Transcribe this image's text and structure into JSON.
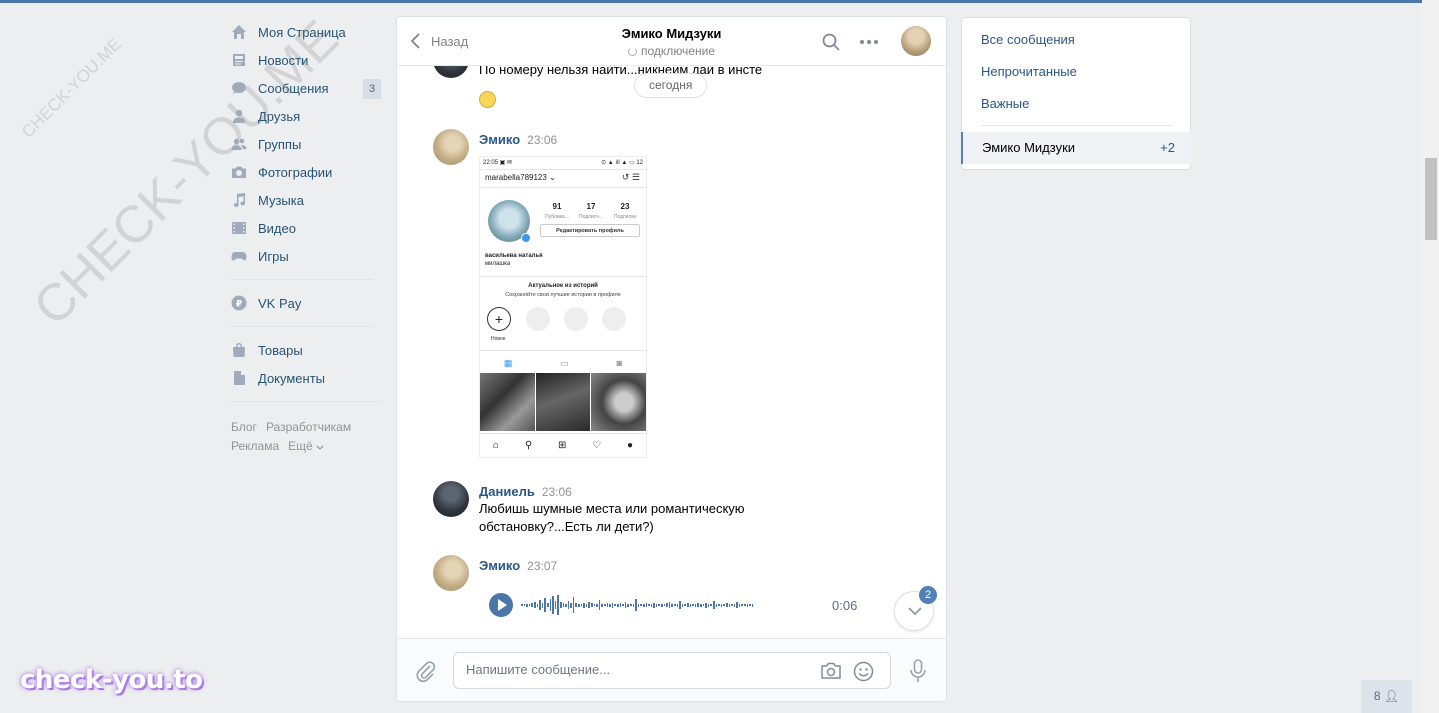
{
  "watermark": {
    "big": "CHECK-YOU.ME",
    "small": "CHECK-YOU.ME",
    "logo": "check-you.to"
  },
  "nav": {
    "items": [
      {
        "label": "Моя Страница",
        "icon": "home-icon"
      },
      {
        "label": "Новости",
        "icon": "news-icon"
      },
      {
        "label": "Сообщения",
        "icon": "messages-icon",
        "badge": "3"
      },
      {
        "label": "Друзья",
        "icon": "friends-icon"
      },
      {
        "label": "Группы",
        "icon": "groups-icon"
      },
      {
        "label": "Фотографии",
        "icon": "camera-icon"
      },
      {
        "label": "Музыка",
        "icon": "music-icon"
      },
      {
        "label": "Видео",
        "icon": "video-icon"
      },
      {
        "label": "Игры",
        "icon": "games-icon"
      }
    ],
    "pay": {
      "label": "VK Pay",
      "icon": "vkpay-icon"
    },
    "items2": [
      {
        "label": "Товары",
        "icon": "bag-icon"
      },
      {
        "label": "Документы",
        "icon": "document-icon"
      }
    ],
    "footer": {
      "blog": "Блог",
      "devs": "Разработчикам",
      "ads": "Реклама",
      "more": "Ещё"
    }
  },
  "chat": {
    "back": "Назад",
    "title": "Эмико Мидзуки",
    "status": "подключение",
    "day": "сегодня",
    "messages": {
      "m0": {
        "text": "По номеру нельзя найти...никнеим дай в инсте"
      },
      "m1": {
        "author": "Эмико",
        "time": "23:06"
      },
      "m2": {
        "author": "Даниель",
        "time": "23:06",
        "text": "Любишь шумные места или романтическую обстановку?...Есть ли дети?)"
      },
      "m3": {
        "author": "Эмико",
        "time": "23:07",
        "duration": "0:06"
      }
    },
    "shot": {
      "statusbar_left": "22:05 ▣ ✉",
      "statusbar_right": "⊙ ▲ ıll ▲ ▭ 12",
      "username": "marabella789123 ⌄",
      "stats": [
        "91",
        "17",
        "23"
      ],
      "stat_labels": [
        "Публика...",
        "Подписч...",
        "Подписки"
      ],
      "edit": "Редактировать профиль",
      "bio_name": "васильева наталья",
      "bio_text": "милашка",
      "highlights_title": "Актуальное из историй",
      "highlights_sub": "Сохраняйте свои лучшие истории в профиле",
      "new_label": "Новое"
    },
    "scroll_badge": "2",
    "composer": {
      "placeholder": "Напишите сообщение..."
    }
  },
  "right": {
    "all": "Все сообщения",
    "unread": "Непрочитанные",
    "important": "Важные",
    "active_name": "Эмико Мидзуки",
    "active_count": "+2"
  },
  "online": "8",
  "colors": {
    "accent": "#4a76a8",
    "link": "#2a5885",
    "bg": "#edeef0"
  }
}
